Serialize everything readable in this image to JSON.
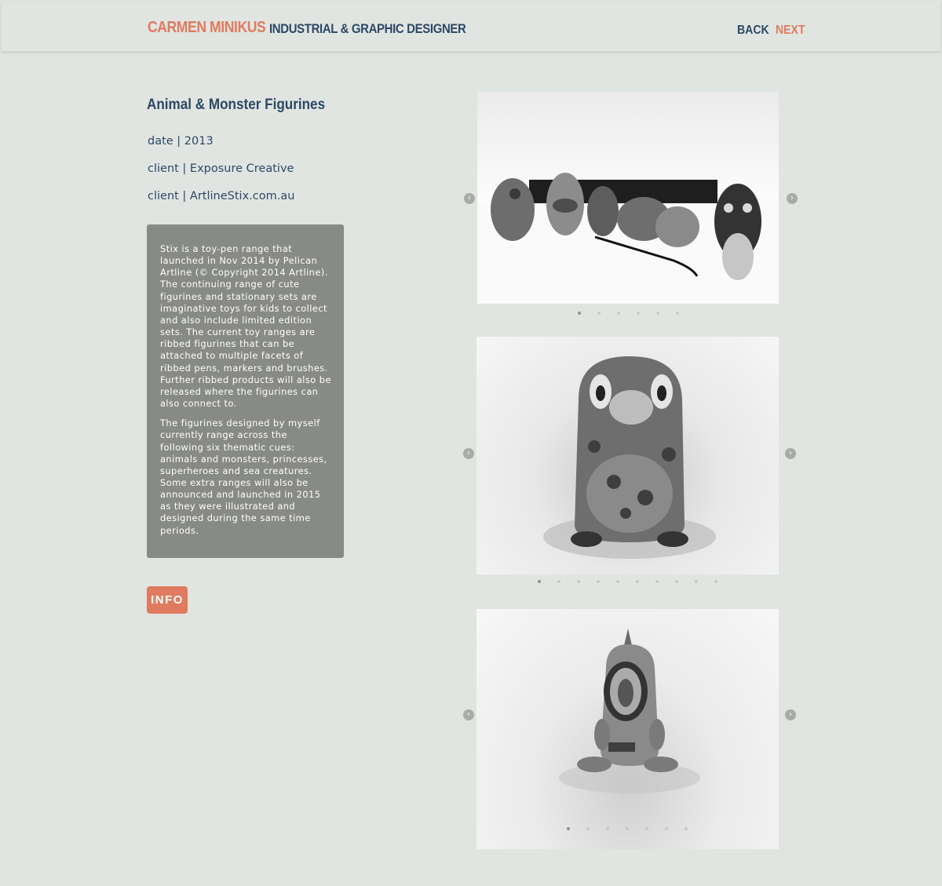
{
  "header": {
    "brand_name": "CARMEN MINIKUS",
    "brand_role": "INDUSTRIAL & GRAPHIC DESIGNER",
    "back_label": "BACK",
    "next_label": "NEXT"
  },
  "project": {
    "title": "Animal & Monster Figurines",
    "meta": [
      "date | 2013",
      "client | Exposure Creative",
      "client | ArtlineStix.com.au"
    ],
    "description": [
      "Stix is a toy-pen range that launched in Nov 2014 by Pelican Artline (© Copyright 2014 Artline). The continuing range of cute figurines and stationary sets are imaginative toys for kids to collect and also include limited edition sets. The current toy ranges are ribbed figurines that can be attached to multiple facets of ribbed pens, markers and brushes. Further ribbed products will also be released where the figurines can also connect to.",
      "The figurines designed by myself currently range across the following six thematic cues: animals and monsters, princesses, superheroes and sea creatures. Some extra ranges will also be announced and launched in 2015 as they were illustrated and designed during the same time periods."
    ],
    "info_label": "INFO"
  },
  "sliders": [
    {
      "dot_count": 6,
      "active": 0
    },
    {
      "dot_count": 10,
      "active": 0
    },
    {
      "dot_count": 7,
      "active": 0
    }
  ],
  "colors": {
    "accent": "#e07b5f",
    "navy": "#2d4866",
    "background": "#e1e5e1",
    "panel": "#888a86"
  }
}
